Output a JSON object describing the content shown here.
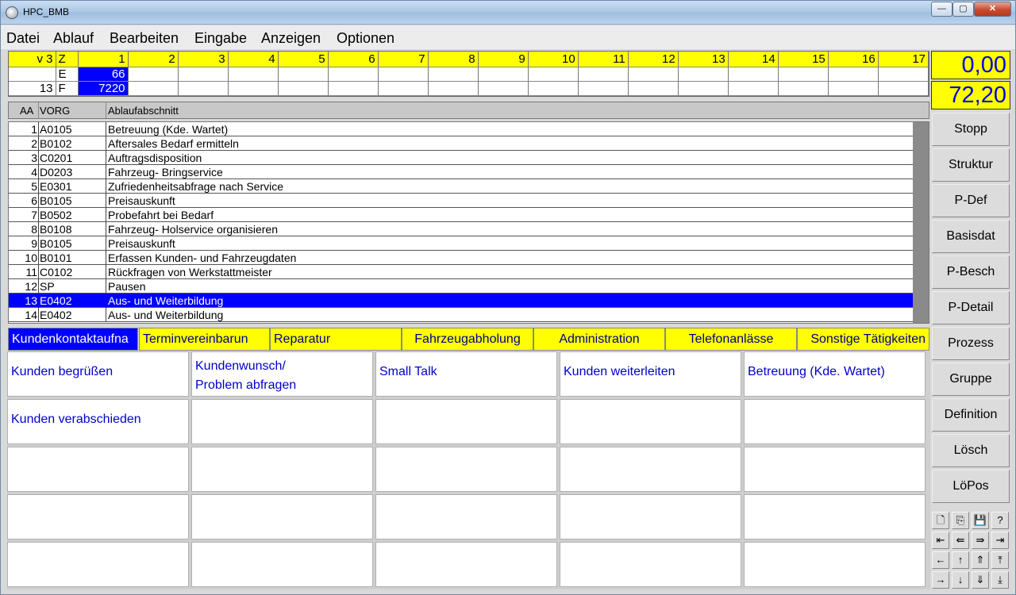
{
  "window": {
    "title": "HPC_BMB",
    "minimize": "—",
    "maximize": "▢",
    "close": "✕"
  },
  "menu": [
    "Datei",
    "Ablauf",
    "Bearbeiten",
    "Eingabe",
    "Anzeigen",
    "Optionen"
  ],
  "top_grid": {
    "corner": "v 3",
    "z_label": "Z",
    "columns": [
      "1",
      "2",
      "3",
      "4",
      "5",
      "6",
      "7",
      "8",
      "9",
      "10",
      "11",
      "12",
      "13",
      "14",
      "15",
      "16",
      "17"
    ],
    "rows": [
      {
        "a": "",
        "b": "E",
        "c1": "66"
      },
      {
        "a": "13",
        "b": "F",
        "c1": "7220"
      }
    ]
  },
  "values": {
    "top": "0,00",
    "bottom": "72,20"
  },
  "list_header": {
    "aa": "AA",
    "vorg": "VORG",
    "ablauf": "Ablaufabschnitt"
  },
  "list_rows": [
    {
      "n": "1",
      "code": "A0105",
      "text": "Betreuung (Kde. Wartet)"
    },
    {
      "n": "2",
      "code": "B0102",
      "text": "Aftersales Bedarf ermitteln"
    },
    {
      "n": "3",
      "code": "C0201",
      "text": "Auftragsdisposition"
    },
    {
      "n": "4",
      "code": "D0203",
      "text": "Fahrzeug- Bringservice"
    },
    {
      "n": "5",
      "code": "E0301",
      "text": "Zufriedenheitsabfrage nach Service"
    },
    {
      "n": "6",
      "code": "B0105",
      "text": "Preisauskunft"
    },
    {
      "n": "7",
      "code": "B0502",
      "text": "Probefahrt bei Bedarf"
    },
    {
      "n": "8",
      "code": "B0108",
      "text": "Fahrzeug- Holservice organisieren"
    },
    {
      "n": "9",
      "code": "B0105",
      "text": "Preisauskunft"
    },
    {
      "n": "10",
      "code": "B0101",
      "text": "Erfassen Kunden- und Fahrzeugdaten"
    },
    {
      "n": "11",
      "code": "C0102",
      "text": "Rückfragen von Werkstattmeister"
    },
    {
      "n": "12",
      "code": "SP",
      "text": "Pausen"
    },
    {
      "n": "13",
      "code": "E0402",
      "text": "Aus- und Weiterbildung"
    },
    {
      "n": "14",
      "code": "E0402",
      "text": "Aus- und Weiterbildung"
    }
  ],
  "selected_row": 13,
  "tabs": [
    "Kundenkontaktaufna",
    "Terminvereinbarun",
    "Reparatur",
    "Fahrzeugabholung",
    "Administration",
    "Telefonanlässe",
    "Sonstige Tätigkeiten"
  ],
  "active_tab": "Kundenkontaktaufna",
  "activities": [
    [
      "Kunden begrüßen",
      "Kundenwunsch/\nProblem abfragen",
      "Small Talk",
      "Kunden  weiterleiten",
      "Betreuung (Kde. Wartet)"
    ],
    [
      "Kunden verabschieden",
      "",
      "",
      "",
      ""
    ],
    [
      "",
      "",
      "",
      "",
      ""
    ],
    [
      "",
      "",
      "",
      "",
      ""
    ],
    [
      "",
      "",
      "",
      "",
      ""
    ]
  ],
  "side_buttons": [
    "Stopp",
    "Struktur",
    "P-Def",
    "Basisdat",
    "P-Besch",
    "P-Detail",
    "Prozess",
    "Gruppe",
    "Definition",
    "Lösch",
    "LöPos"
  ],
  "icon_buttons": [
    [
      {
        "name": "new-doc-icon",
        "glyph": "🗋"
      },
      {
        "name": "copy-icon",
        "glyph": "⎘"
      },
      {
        "name": "save-icon",
        "glyph": "💾"
      },
      {
        "name": "help-icon",
        "glyph": "?"
      }
    ],
    [
      {
        "name": "first-icon",
        "glyph": "⇤"
      },
      {
        "name": "prev-fast-icon",
        "glyph": "⇚"
      },
      {
        "name": "next-fast-icon",
        "glyph": "⇛"
      },
      {
        "name": "last-icon",
        "glyph": "⇥"
      }
    ],
    [
      {
        "name": "left-icon",
        "glyph": "←"
      },
      {
        "name": "up-icon",
        "glyph": "↑"
      },
      {
        "name": "up-fast-icon",
        "glyph": "⇑"
      },
      {
        "name": "top-icon",
        "glyph": "⤒"
      }
    ],
    [
      {
        "name": "right-icon",
        "glyph": "→"
      },
      {
        "name": "down-icon",
        "glyph": "↓"
      },
      {
        "name": "down-fast-icon",
        "glyph": "⇓"
      },
      {
        "name": "bottom-icon",
        "glyph": "⤓"
      }
    ]
  ],
  "colors": {
    "highlight": "#0000ff",
    "yellow": "#ffff00",
    "value_text": "#0000e0"
  }
}
